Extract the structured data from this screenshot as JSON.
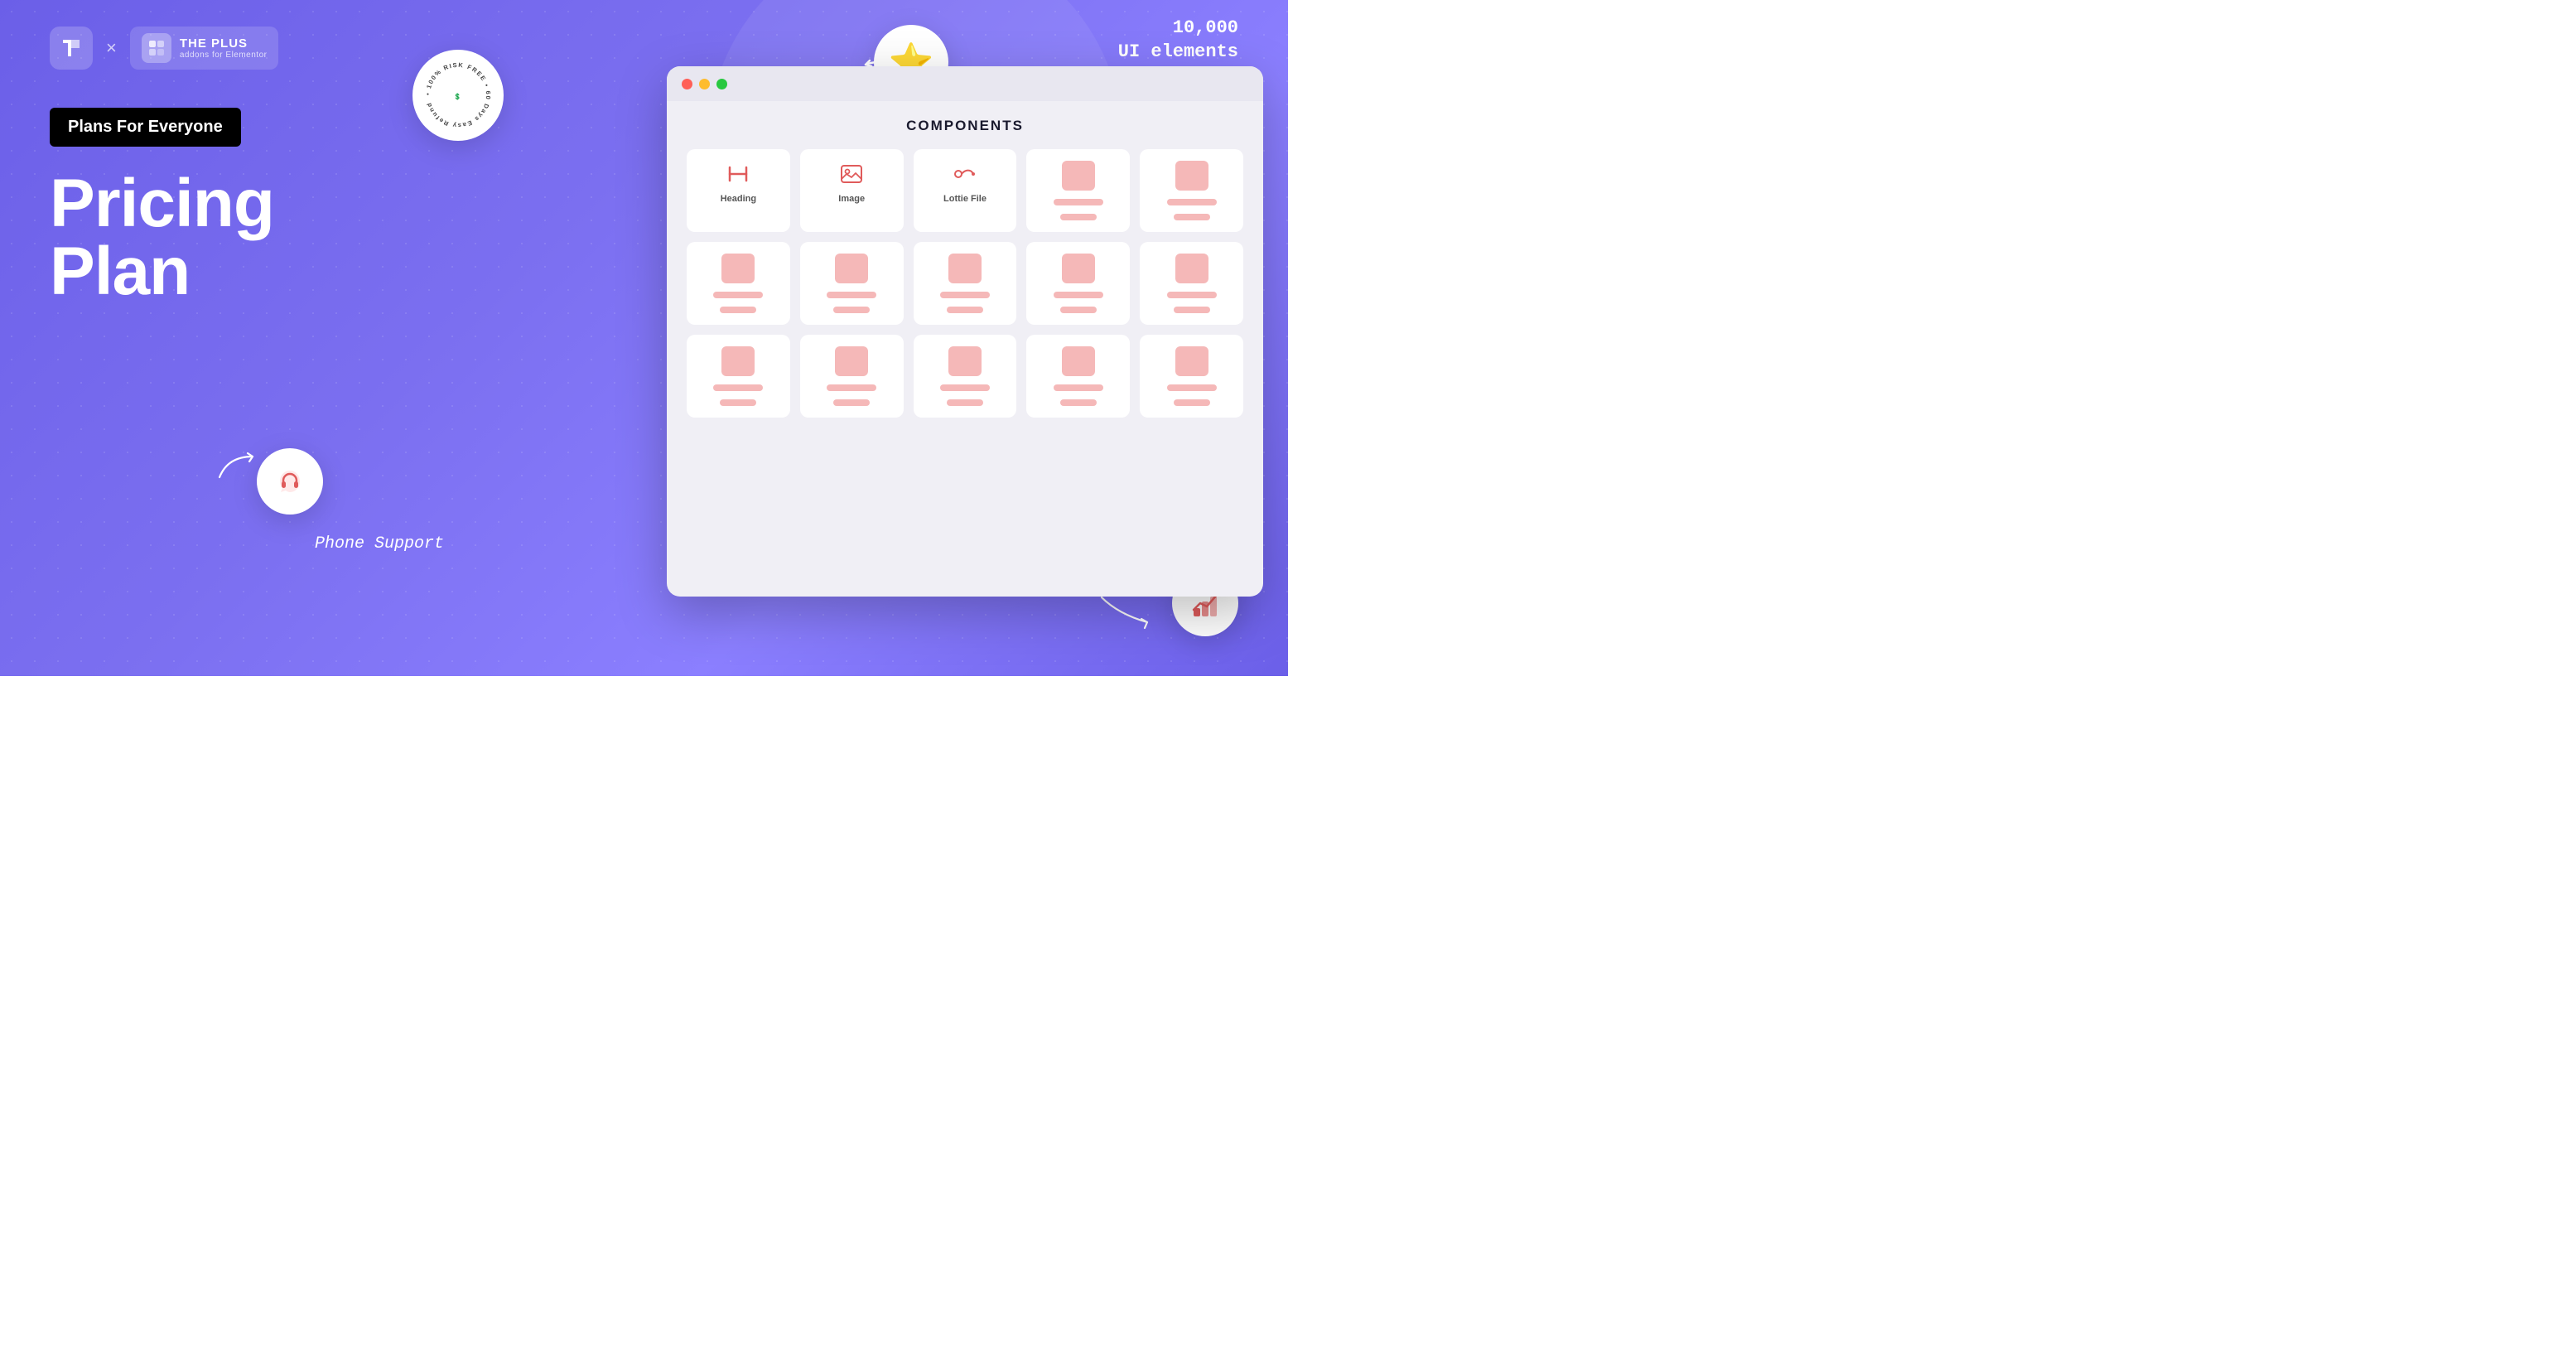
{
  "brand": {
    "logo_symbol": "✦",
    "logo_plus_icon": "⊞",
    "logo_title": "THE PLUS",
    "logo_subtitle": "addons for Elementor",
    "separator": "×"
  },
  "badge": {
    "plans_label": "Plans For Everyone"
  },
  "hero": {
    "title_line1": "Pricing",
    "title_line2": "Plan"
  },
  "risk_free": {
    "line1": "100% RISK FREE",
    "line2": "60 Days Easy Refund"
  },
  "ui_elements": {
    "count": "10,000",
    "label": "UI elements"
  },
  "phone_support": {
    "label": "Phone Support"
  },
  "analytics": {
    "label": "Analytics Service"
  },
  "components": {
    "title": "COMPONENTS",
    "items": [
      {
        "id": "heading",
        "label": "Heading",
        "type": "named"
      },
      {
        "id": "image",
        "label": "Image",
        "type": "named"
      },
      {
        "id": "lottie",
        "label": "Lottie File",
        "type": "named"
      },
      {
        "id": "ph1",
        "label": "",
        "type": "placeholder"
      },
      {
        "id": "ph2",
        "label": "",
        "type": "placeholder"
      },
      {
        "id": "ph3",
        "label": "",
        "type": "placeholder"
      },
      {
        "id": "ph4",
        "label": "",
        "type": "placeholder"
      },
      {
        "id": "ph5",
        "label": "",
        "type": "placeholder"
      },
      {
        "id": "ph6",
        "label": "",
        "type": "placeholder"
      },
      {
        "id": "ph7",
        "label": "",
        "type": "placeholder"
      },
      {
        "id": "ph8",
        "label": "",
        "type": "placeholder"
      },
      {
        "id": "ph9",
        "label": "",
        "type": "placeholder"
      },
      {
        "id": "ph10",
        "label": "",
        "type": "placeholder"
      },
      {
        "id": "ph11",
        "label": "",
        "type": "placeholder"
      },
      {
        "id": "ph12",
        "label": "",
        "type": "placeholder"
      }
    ]
  },
  "colors": {
    "bg_start": "#6B5FE8",
    "bg_end": "#7B6FF0",
    "white": "#ffffff",
    "accent_pink": "#f5b8b8",
    "accent_red": "#e05b5b"
  }
}
